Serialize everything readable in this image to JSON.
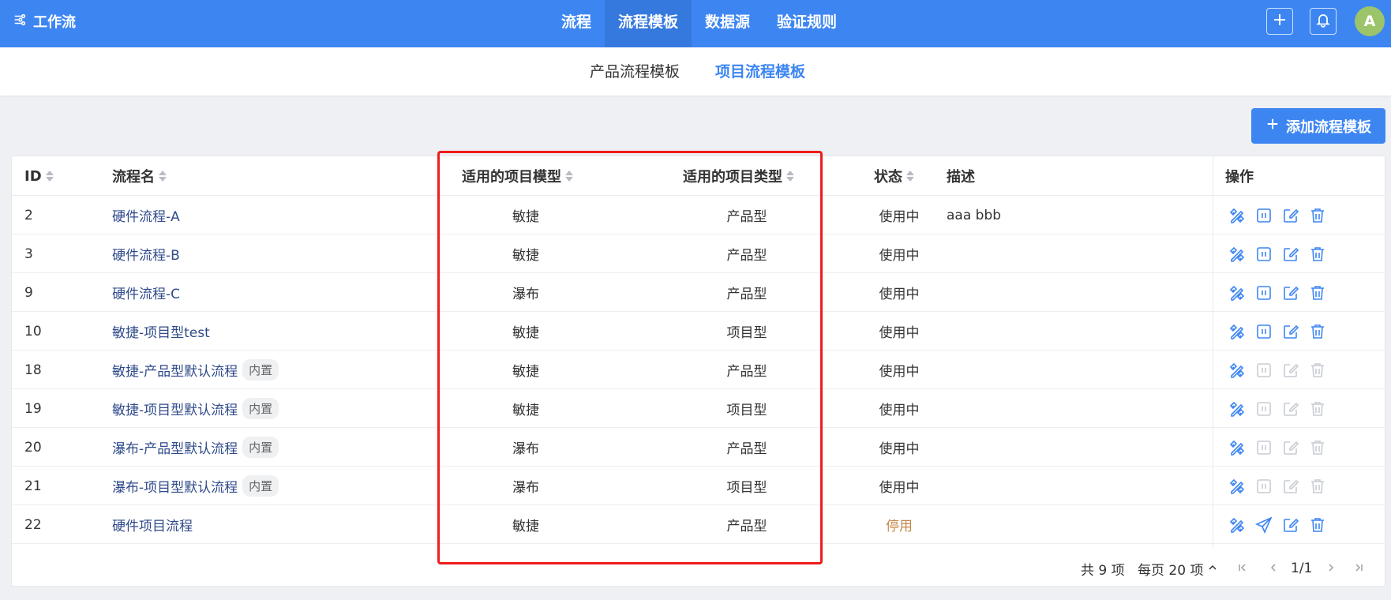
{
  "app": {
    "title": "工作流"
  },
  "nav": {
    "items": [
      "流程",
      "流程模板",
      "数据源",
      "验证规则"
    ],
    "active": 1
  },
  "user": {
    "avatar_initial": "A"
  },
  "subtabs": {
    "items": [
      "产品流程模板",
      "项目流程模板"
    ],
    "active": 1
  },
  "toolbar": {
    "add_label": "添加流程模板"
  },
  "table": {
    "headers": {
      "id": "ID",
      "name": "流程名",
      "model": "适用的项目模型",
      "type": "适用的项目类型",
      "status": "状态",
      "desc": "描述",
      "ops": "操作"
    },
    "rows": [
      {
        "id": "2",
        "name": "硬件流程-A",
        "badge": "",
        "model": "敏捷",
        "type": "产品型",
        "status": "使用中",
        "desc": "aaa bbb"
      },
      {
        "id": "3",
        "name": "硬件流程-B",
        "badge": "",
        "model": "敏捷",
        "type": "产品型",
        "status": "使用中",
        "desc": ""
      },
      {
        "id": "9",
        "name": "硬件流程-C",
        "badge": "",
        "model": "瀑布",
        "type": "产品型",
        "status": "使用中",
        "desc": ""
      },
      {
        "id": "10",
        "name": "敏捷-项目型test",
        "badge": "",
        "model": "敏捷",
        "type": "项目型",
        "status": "使用中",
        "desc": ""
      },
      {
        "id": "18",
        "name": "敏捷-产品型默认流程",
        "badge": "内置",
        "model": "敏捷",
        "type": "产品型",
        "status": "使用中",
        "desc": ""
      },
      {
        "id": "19",
        "name": "敏捷-项目型默认流程",
        "badge": "内置",
        "model": "敏捷",
        "type": "项目型",
        "status": "使用中",
        "desc": ""
      },
      {
        "id": "20",
        "name": "瀑布-产品型默认流程",
        "badge": "内置",
        "model": "瀑布",
        "type": "产品型",
        "status": "使用中",
        "desc": ""
      },
      {
        "id": "21",
        "name": "瀑布-项目型默认流程",
        "badge": "内置",
        "model": "瀑布",
        "type": "项目型",
        "status": "使用中",
        "desc": ""
      },
      {
        "id": "22",
        "name": "硬件项目流程",
        "badge": "",
        "model": "敏捷",
        "type": "产品型",
        "status": "停用",
        "desc": ""
      }
    ]
  },
  "pagination": {
    "total": "共 9 项",
    "page_size": "每页 20 项",
    "page": "1/1"
  },
  "colors": {
    "primary": "#3d86f2",
    "nav_active": "#3579de",
    "stopped": "#c5874a",
    "highlight": "#ee1c1c",
    "avatar": "#9cc46a"
  }
}
